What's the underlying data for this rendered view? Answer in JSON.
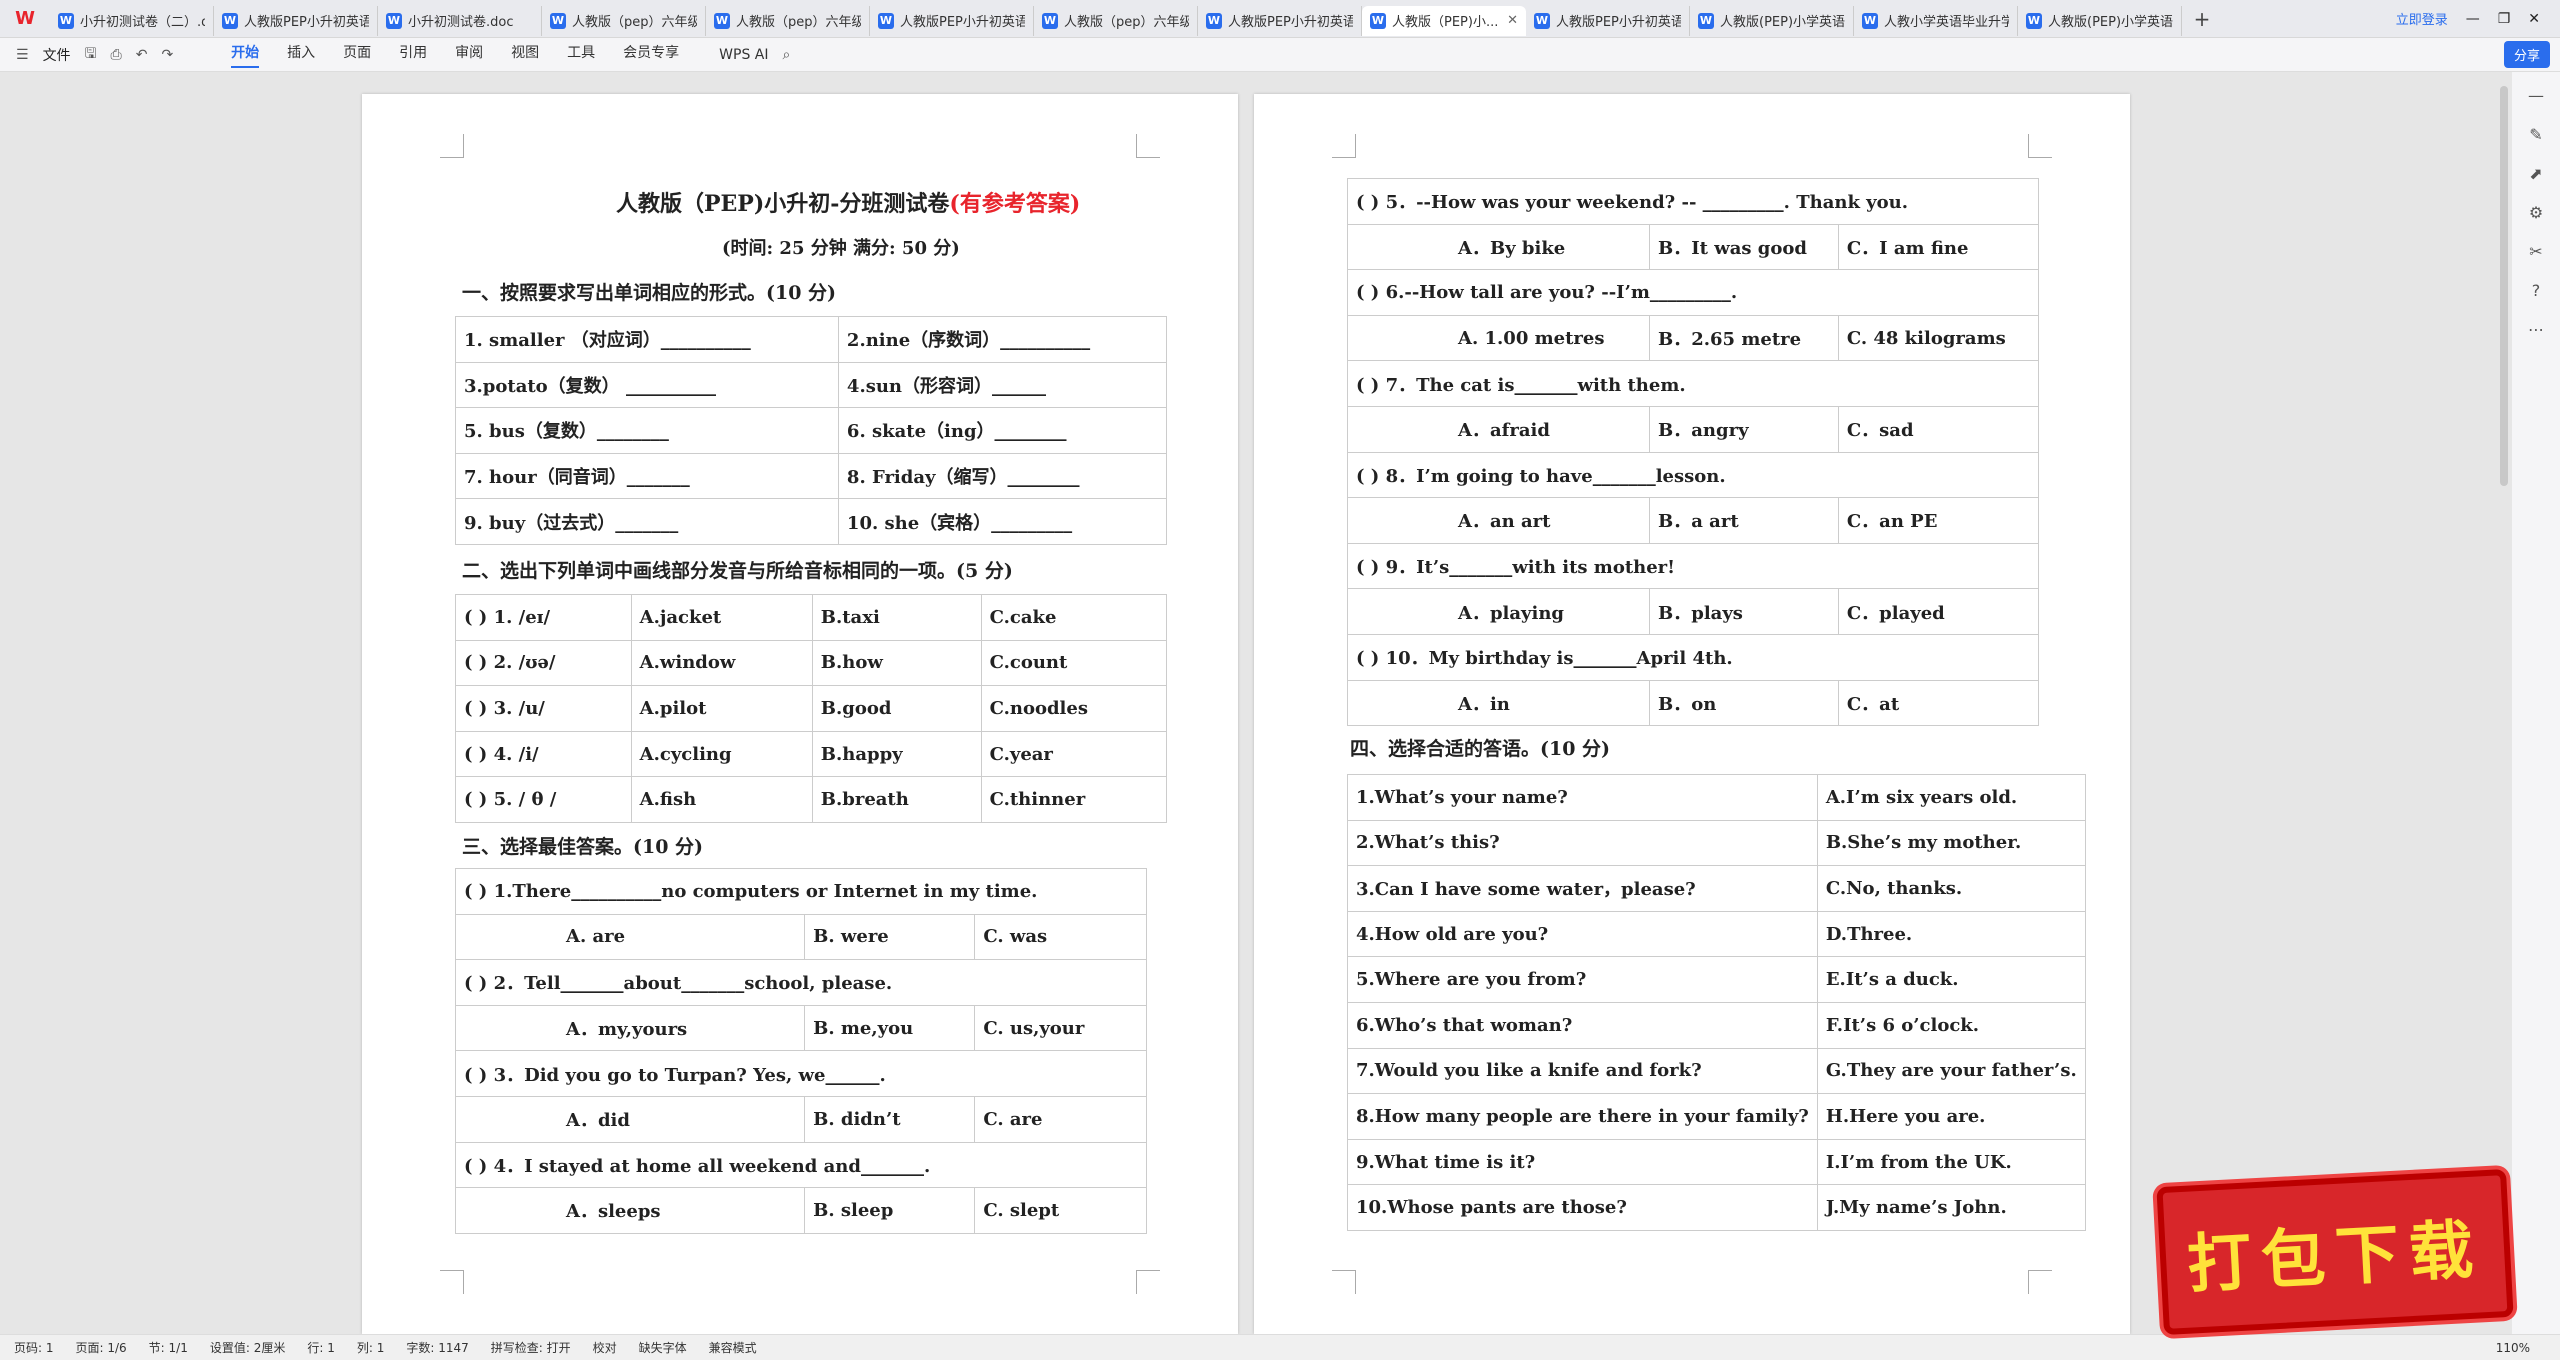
{
  "tabs": [
    {
      "label": "小升初测试卷（二）.docx",
      "active": false
    },
    {
      "label": "人教版PEP小升初英语...",
      "active": false
    },
    {
      "label": "小升初测试卷.doc",
      "active": false
    },
    {
      "label": "人教版（pep）六年级...",
      "active": false
    },
    {
      "label": "人教版（pep）六年级...",
      "active": false
    },
    {
      "label": "人教版PEP小升初英语...",
      "active": false
    },
    {
      "label": "人教版（pep）六年级...",
      "active": false
    },
    {
      "label": "人教版PEP小升初英语...",
      "active": false
    },
    {
      "label": "人教版（PEP)小...",
      "active": true
    },
    {
      "label": "人教版PEP小升初英语...",
      "active": false
    },
    {
      "label": "人教版(PEP)小学英语...",
      "active": false
    },
    {
      "label": "人教小学英语毕业升学...",
      "active": false
    },
    {
      "label": "人教版(PEP)小学英语...",
      "active": false
    }
  ],
  "login_label": "立即登录",
  "toolbar": {
    "file": "文件",
    "menus": [
      "开始",
      "插入",
      "页面",
      "引用",
      "审阅",
      "视图",
      "工具",
      "会员专享"
    ],
    "ai": "WPS AI",
    "share": "分享"
  },
  "doc": {
    "title": "人教版（PEP)小升初-分班测试卷",
    "title_red": "(有参考答案)",
    "subtitle": "(时间: 25 分钟    满分: 50 分)",
    "s1": "一、按照要求写出单词相应的形式。(10 分)",
    "t1": [
      [
        "1. smaller   （对应词）__________",
        "2.nine（序数词）__________"
      ],
      [
        "3.potato（复数）  __________",
        "4.sun（形容词）______"
      ],
      [
        "5.  bus（复数）________",
        "6.  skate（ing）________"
      ],
      [
        "7. hour（同音词）_______",
        "8. Friday（缩写）________"
      ],
      [
        "9. buy（过去式）_______",
        "10. she（宾格）_________"
      ]
    ],
    "s2": "二、选出下列单词中画线部分发音与所给音标相同的一项。(5 分)",
    "t2": [
      [
        "(      ) 1.   /eɪ/",
        "A.jacket",
        "B.taxi",
        "C.cake"
      ],
      [
        "(      ) 2.   /ʊə/",
        "A.window",
        "B.how",
        "C.count"
      ],
      [
        "(      ) 3.   /u/",
        "A.pilot",
        "B.good",
        "C.noodles"
      ],
      [
        "(      ) 4.   /i/",
        "A.cycling",
        "B.happy",
        "C.year"
      ],
      [
        "(      ) 5.   / θ /",
        "A.fish",
        "B.breath",
        "C.thinner"
      ]
    ],
    "s3": "三、选择最佳答案。(10 分)",
    "t3": [
      [
        "(        ) 1.There__________no computers or Internet in my time.",
        "",
        ""
      ],
      [
        "A. are",
        "B.   were",
        "C. was"
      ],
      [
        "(        ) 2．Tell_______about_______school, please.",
        "",
        ""
      ],
      [
        "A．my,yours",
        "B.   me,you",
        "C.   us,your"
      ],
      [
        "(        ) 3．Did you go to Turpan?      Yes, we______.",
        "",
        ""
      ],
      [
        "A．did",
        "B.   didn’t",
        "C.   are"
      ],
      [
        "(        ) 4．I stayed at home all weekend and_______.",
        "",
        ""
      ],
      [
        "A．sleeps",
        "B.   sleep",
        "C.   slept"
      ]
    ],
    "t4": [
      [
        "(        ) 5．--How was your weekend? --  _________. Thank you.",
        "",
        ""
      ],
      [
        "A．By bike",
        "B．It was good",
        "C．I am fine"
      ],
      [
        "(        ) 6.--How tall are you? --I’m_________.",
        "",
        ""
      ],
      [
        "A. 1.00 metres",
        "B．2.65 metre",
        "C. 48 kilograms"
      ],
      [
        "(        ) 7．The cat is_______with them.",
        "",
        ""
      ],
      [
        "A．afraid",
        "B．angry",
        "C．sad"
      ],
      [
        "(        ) 8．I’m going to have_______lesson.",
        "",
        ""
      ],
      [
        "A．an art",
        "B．a art",
        "C．an PE"
      ],
      [
        "(        ) 9．It’s_______with its mother!",
        "",
        ""
      ],
      [
        "A．playing",
        "B．plays",
        "C．played"
      ],
      [
        "(        ) 10．My birthday is_______April 4th.",
        "",
        ""
      ],
      [
        "A．in",
        "B．on",
        "C．at"
      ]
    ],
    "s4": "四、选择合适的答语。(10 分)",
    "t5": [
      [
        "1.What’s your name?",
        "A.I’m six years old."
      ],
      [
        "2.What’s  this?",
        "B.She’s my mother."
      ],
      [
        "3.Can I have some water，please?",
        "C.No, thanks."
      ],
      [
        "4.How old are you?",
        "D.Three."
      ],
      [
        "5.Where are you from?",
        "E.It’s  a  duck."
      ],
      [
        "6.Who’s that woman?",
        "F.It’s 6 o’clock."
      ],
      [
        "7.Would you like a knife and fork?",
        "G.They are your father’s."
      ],
      [
        "8.How many people are there in your family?",
        "H.Here you are."
      ],
      [
        "9.What time is it?",
        "I.I’m from the UK."
      ],
      [
        "10.Whose pants are those?",
        "J.My name’s John."
      ]
    ]
  },
  "status": {
    "page": "页码: 1",
    "pages": "页面: 1/6",
    "section": "节: 1/1",
    "setting": "设置值: 2厘米",
    "row": "行: 1",
    "col": "列: 1",
    "words": "字数: 1147",
    "spell": "拼写检查: 打开",
    "proof": "校对",
    "font": "缺失字体",
    "compat": "兼容模式",
    "zoom": "110%"
  },
  "promo": "打包下载"
}
